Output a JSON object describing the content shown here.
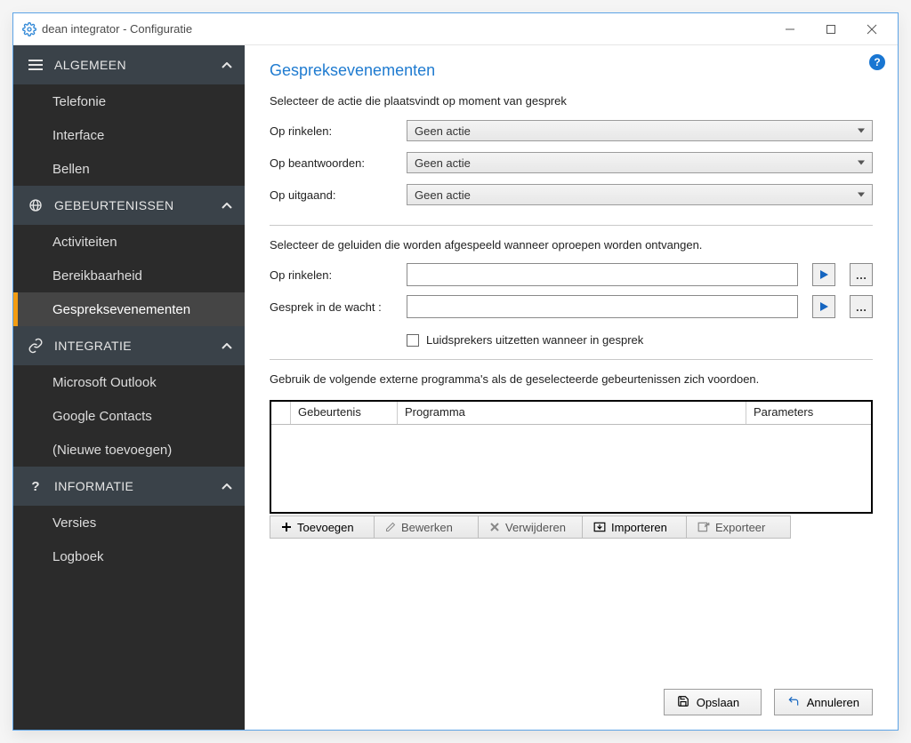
{
  "window": {
    "title": "dean integrator - Configuratie"
  },
  "sidebar": {
    "sections": [
      {
        "key": "algemeen",
        "label": "ALGEMEEN",
        "icon": "menu-icon",
        "items": [
          {
            "label": "Telefonie",
            "active": false
          },
          {
            "label": "Interface",
            "active": false
          },
          {
            "label": "Bellen",
            "active": false
          }
        ]
      },
      {
        "key": "gebeurtenissen",
        "label": "GEBEURTENISSEN",
        "icon": "globe-icon",
        "items": [
          {
            "label": "Activiteiten",
            "active": false
          },
          {
            "label": "Bereikbaarheid",
            "active": false
          },
          {
            "label": "Gespreksevenementen",
            "active": true
          }
        ]
      },
      {
        "key": "integratie",
        "label": "INTEGRATIE",
        "icon": "link-icon",
        "items": [
          {
            "label": "Microsoft Outlook",
            "active": false
          },
          {
            "label": "Google Contacts",
            "active": false
          },
          {
            "label": "(Nieuwe toevoegen)",
            "active": false
          }
        ]
      },
      {
        "key": "informatie",
        "label": "INFORMATIE",
        "icon": "question-icon",
        "items": [
          {
            "label": "Versies",
            "active": false
          },
          {
            "label": "Logboek",
            "active": false
          }
        ]
      }
    ]
  },
  "main": {
    "title": "Gespreksevenementen",
    "action_subtitle": "Selecteer de actie die plaatsvindt op moment van gesprek",
    "action_rows": {
      "ringing": {
        "label": "Op rinkelen:",
        "value": "Geen actie"
      },
      "answer": {
        "label": "Op beantwoorden:",
        "value": "Geen actie"
      },
      "outgoing": {
        "label": "Op uitgaand:",
        "value": "Geen actie"
      }
    },
    "sound_subtitle": "Selecteer de geluiden die worden afgespeeld wanneer oproepen worden ontvangen.",
    "sound_rows": {
      "ringing": {
        "label": "Op rinkelen:",
        "value": ""
      },
      "hold": {
        "label": "Gesprek in de wacht :",
        "value": ""
      }
    },
    "mute_speakers_label": "Luidsprekers uitzetten wanneer in gesprek",
    "mute_speakers_checked": false,
    "programs_subtitle": "Gebruik de volgende externe programma's als de geselecteerde gebeurtenissen zich voordoen.",
    "table": {
      "columns": {
        "event": "Gebeurtenis",
        "program": "Programma",
        "params": "Parameters"
      }
    },
    "toolbar": {
      "add": "Toevoegen",
      "edit": "Bewerken",
      "delete": "Verwijderen",
      "import": "Importeren",
      "export": "Exporteer"
    },
    "footer": {
      "save": "Opslaan",
      "cancel": "Annuleren"
    }
  },
  "colors": {
    "accent_blue": "#1f7bd0",
    "active_orange": "#f39c12",
    "sidebar_bg": "#2b2b2b",
    "section_bg": "#3a4249"
  }
}
